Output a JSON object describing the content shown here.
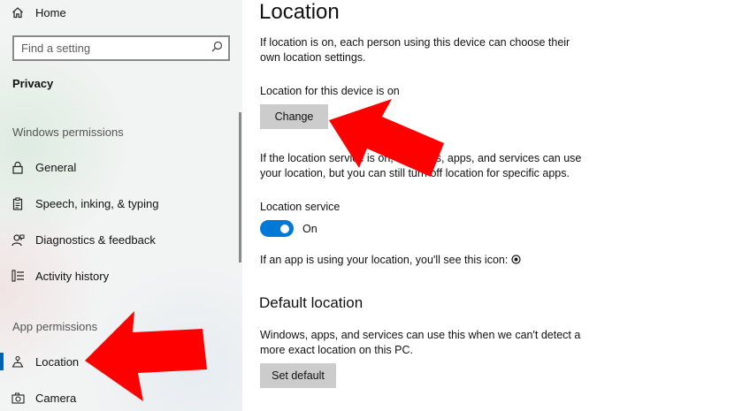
{
  "sidebar": {
    "home_label": "Home",
    "search_placeholder": "Find a setting",
    "section_title": "Privacy",
    "windows_permissions_title": "Windows permissions",
    "windows_items": [
      {
        "label": "General",
        "icon": "lock-icon"
      },
      {
        "label": "Speech, inking, & typing",
        "icon": "clipboard-icon"
      },
      {
        "label": "Diagnostics & feedback",
        "icon": "person-feedback-icon"
      },
      {
        "label": "Activity history",
        "icon": "activity-history-icon"
      }
    ],
    "app_permissions_title": "App permissions",
    "app_items": [
      {
        "label": "Location",
        "icon": "location-icon",
        "selected": true
      },
      {
        "label": "Camera",
        "icon": "camera-icon"
      }
    ]
  },
  "main": {
    "title": "Location",
    "intro": [
      "If location is on, each person using this device can choose their",
      "own location settings."
    ],
    "device_status": "Location for this device is on",
    "change_button": "Change",
    "info": [
      "If the location service is on, Windows, apps, and services can use",
      "your location, but you can still turn off location for specific apps."
    ],
    "service_label": "Location service",
    "service_state": "On",
    "icon_note": "If an app is using your location, you'll see this icon:",
    "default_title": "Default location",
    "default_text": [
      "Windows, apps, and services can use this when we can't detect a",
      "more exact location on this PC."
    ],
    "set_default_button": "Set default"
  },
  "colors": {
    "accent": "#0078d7",
    "selected_bar": "#0063b1",
    "arrow": "#ff0000",
    "button_bg": "#cccccc"
  }
}
